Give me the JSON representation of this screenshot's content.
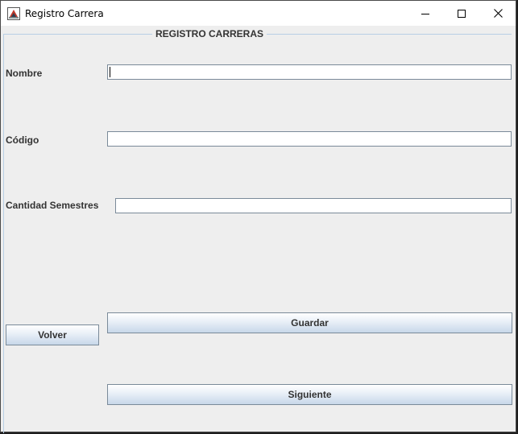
{
  "window": {
    "title": "Registro Carrera",
    "icon": "java-app-icon",
    "controls": [
      "minimize-icon",
      "maximize-icon",
      "close-icon"
    ]
  },
  "form": {
    "group_title": "REGISTRO CARRERAS",
    "fields": {
      "nombre": {
        "label": "Nombre",
        "value": ""
      },
      "codigo": {
        "label": "Código",
        "value": ""
      },
      "cantidad_semestres": {
        "label": "Cantidad Semestres",
        "value": ""
      }
    },
    "buttons": {
      "volver": "Volver",
      "guardar": "Guardar",
      "siguiente": "Siguiente"
    }
  }
}
